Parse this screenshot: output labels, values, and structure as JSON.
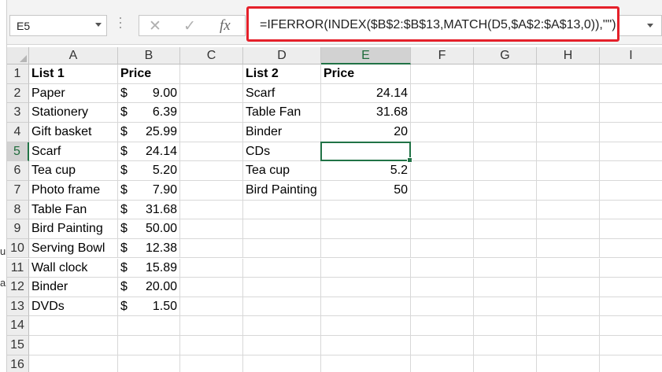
{
  "name_box": "E5",
  "formula_bar": {
    "fx_label": "fx",
    "cancel_icon": "cancel-icon",
    "enter_icon": "check-icon",
    "formula": "=IFERROR(INDEX($B$2:$B$13,MATCH(D5,$A$2:$A$13,0)),\"\")"
  },
  "columns": [
    "A",
    "B",
    "C",
    "D",
    "E",
    "F",
    "G",
    "H",
    "I"
  ],
  "rows": [
    "1",
    "2",
    "3",
    "4",
    "5",
    "6",
    "7",
    "8",
    "9",
    "10",
    "11",
    "12",
    "13",
    "14",
    "15",
    "16"
  ],
  "selected": {
    "col": "E",
    "row": "5"
  },
  "accent_color": "#217346",
  "highlight_color": "#e5202a",
  "cells": {
    "A1": "List 1",
    "B1": "Price",
    "D1": "List 2",
    "E1": "Price",
    "A2": "Paper",
    "A3": "Stationery",
    "A4": "Gift basket",
    "A5": "Scarf",
    "A6": "Tea cup",
    "A7": "Photo frame",
    "A8": "Table Fan",
    "A9": "Bird Painting",
    "A10": "Serving Bowl",
    "A11": "Wall clock",
    "A12": "Binder",
    "A13": "DVDs",
    "B2": "9.00",
    "B3": "6.39",
    "B4": "25.99",
    "B5": "24.14",
    "B6": "5.20",
    "B7": "7.90",
    "B8": "31.68",
    "B9": "50.00",
    "B10": "12.38",
    "B11": "15.89",
    "B12": "20.00",
    "B13": "1.50",
    "D2": "Scarf",
    "D3": "Table Fan",
    "D4": "Binder",
    "D5": "CDs",
    "D6": "Tea cup",
    "D7": "Bird Painting",
    "E2": "24.14",
    "E3": "31.68",
    "E4": "20",
    "E5": "",
    "E6": "5.2",
    "E7": "50"
  },
  "currency_symbol": "$",
  "edge_chars": [
    "u",
    "a"
  ]
}
